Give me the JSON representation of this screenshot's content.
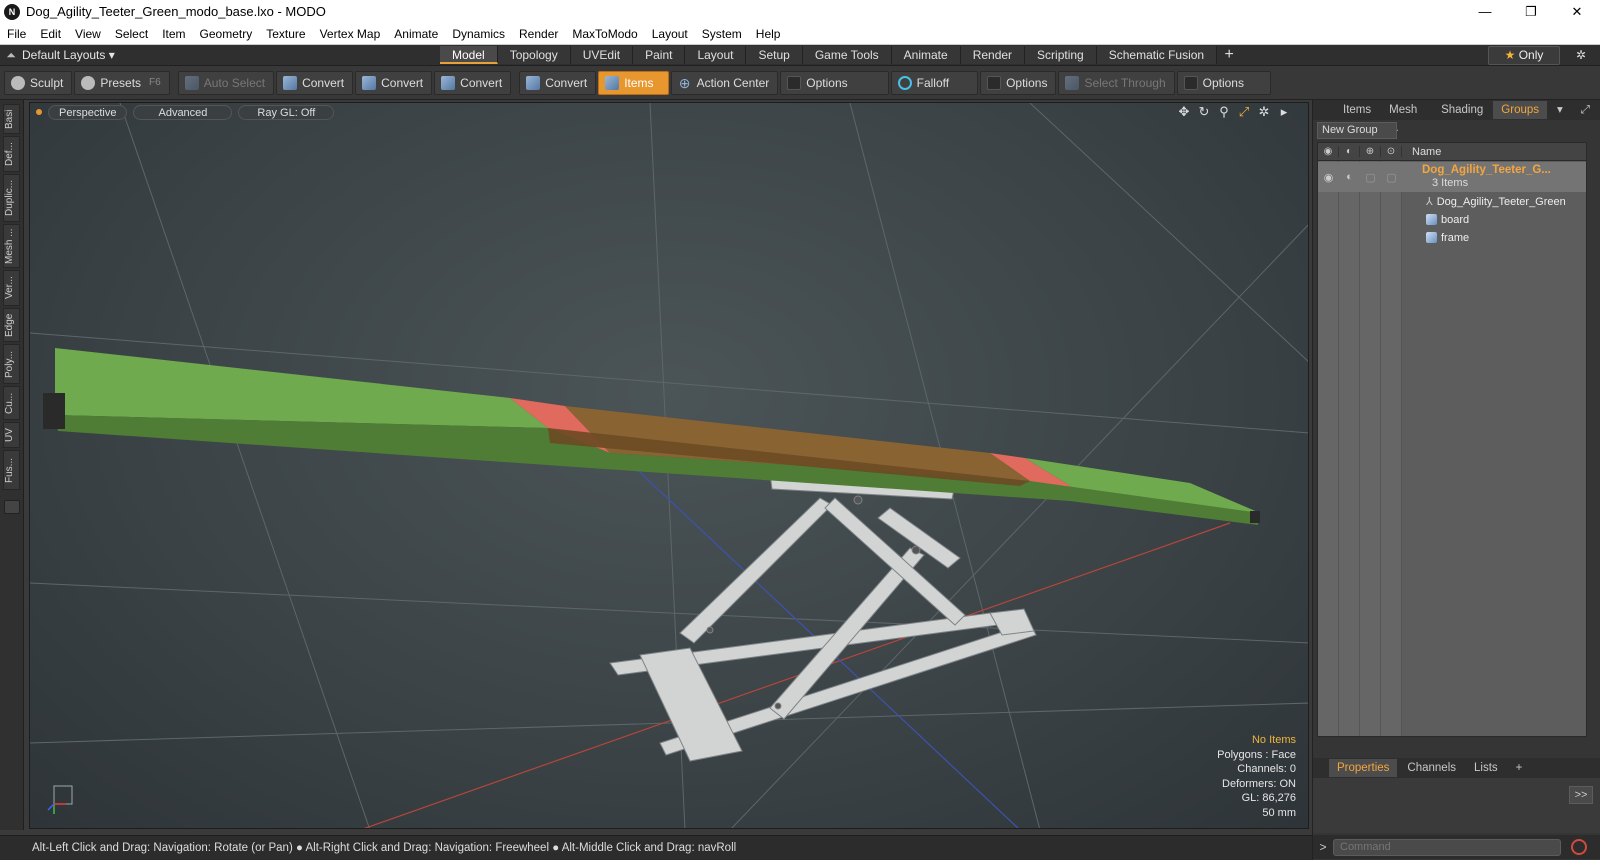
{
  "window": {
    "title": "Dog_Agility_Teeter_Green_modo_base.lxo - MODO",
    "app_icon": "N",
    "minimize": "—",
    "maximize": "❐",
    "close": "✕"
  },
  "menu": [
    "File",
    "Edit",
    "View",
    "Select",
    "Item",
    "Geometry",
    "Texture",
    "Vertex Map",
    "Animate",
    "Dynamics",
    "Render",
    "MaxToModo",
    "Layout",
    "System",
    "Help"
  ],
  "layoutbar": {
    "layouts_label": "Default Layouts ▾",
    "tabs": [
      "Model",
      "Topology",
      "UVEdit",
      "Paint",
      "Layout",
      "Setup",
      "Game Tools",
      "Animate",
      "Render",
      "Scripting",
      "Schematic Fusion"
    ],
    "active_tab": "Model",
    "plus": "+",
    "only_label": "Only",
    "only_star": "★"
  },
  "toolbar": {
    "sculpt": "Sculpt",
    "presets": "Presets",
    "presets_key": "F6",
    "auto_select": "Auto Select",
    "convert1": "Convert",
    "convert2": "Convert",
    "convert3": "Convert",
    "convert4": "Convert",
    "items": "Items",
    "action_center": "Action Center",
    "options1": "Options",
    "falloff": "Falloff",
    "options2": "Options",
    "select_through": "Select Through",
    "options3": "Options"
  },
  "left_tabs": [
    "Basi",
    "Def...",
    "Duplic...",
    "Mesh ...",
    "Ver...",
    "Edge",
    "Poly...",
    "Cu...",
    "UV",
    "Fus..."
  ],
  "viewport": {
    "perspective": "Perspective",
    "advanced": "Advanced",
    "raygl": "Ray GL: Off",
    "stats": {
      "no_items": "No Items",
      "polygons": "Polygons : Face",
      "channels": "Channels: 0",
      "deformers": "Deformers: ON",
      "gl": "GL: 86,276",
      "unit": "50 mm"
    }
  },
  "status": "Alt-Left Click and Drag: Navigation: Rotate (or Pan) ● Alt-Right Click and Drag: Navigation: Freewheel ● Alt-Middle Click and Drag: navRoll",
  "right_panel": {
    "tabs": [
      "Items",
      "Mesh ...",
      "Shading",
      "Groups"
    ],
    "active_tab": "Groups",
    "new_group": "New Group",
    "name_header": "Name",
    "group_name": "Dog_Agility_Teeter_G...",
    "group_count": "3 Items",
    "children": [
      "Dog_Agility_Teeter_Green",
      "board",
      "frame"
    ],
    "bottom_tabs": [
      "Properties",
      "Channels",
      "Lists"
    ],
    "bottom_plus": "+",
    "expand_btn": ">>",
    "command_placeholder": "Command",
    "cmd_prompt": ">"
  },
  "colors": {
    "accent": "#e8962e",
    "board_green": "#6faa4f",
    "board_brown": "#8a6332",
    "board_red": "#e06a5d"
  }
}
